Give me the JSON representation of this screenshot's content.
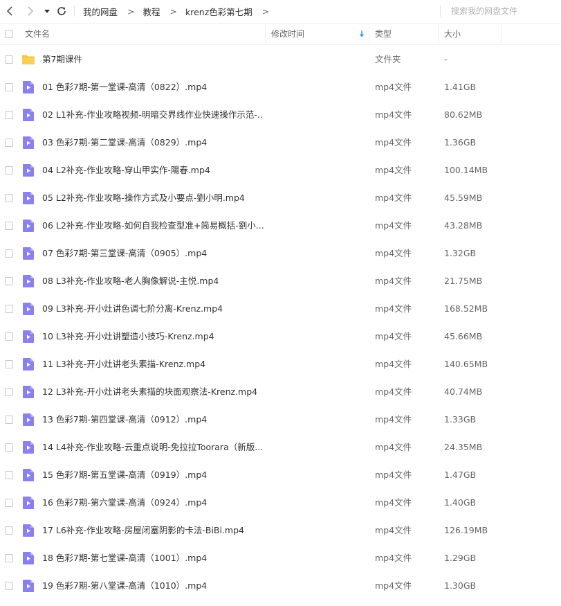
{
  "toolbar": {
    "back_icon": "chevron-left-icon",
    "forward_icon": "chevron-right-icon",
    "dropdown_icon": "caret-down-icon",
    "refresh_icon": "refresh-icon"
  },
  "breadcrumb": {
    "items": [
      "我的网盘",
      "教程",
      "krenz色彩第七期"
    ],
    "separator": ">"
  },
  "search": {
    "placeholder": "搜索我的网盘文件",
    "value": ""
  },
  "columns": {
    "name": "文件名",
    "mtime": "修改时间",
    "type": "类型",
    "size": "大小"
  },
  "colors": {
    "file_icon": "#8b80ef",
    "folder_icon": "#f7c543",
    "sort_arrow": "#2b8cff"
  },
  "files": [
    {
      "name": "第7期课件",
      "type": "文件夹",
      "size": "-",
      "kind": "folder"
    },
    {
      "name": "01  色彩7期-第一堂课-高清（0822）.mp4",
      "type": "mp4文件",
      "size": "1.41GB",
      "kind": "video"
    },
    {
      "name": "02  L1补充-作业攻略视频-明暗交界线作业快速操作示范-...",
      "type": "mp4文件",
      "size": "80.62MB",
      "kind": "video"
    },
    {
      "name": "03  色彩7期-第二堂课-高清（0829）.mp4",
      "type": "mp4文件",
      "size": "1.36GB",
      "kind": "video"
    },
    {
      "name": "04  L2补充-作业攻略-穿山甲实作-陽春.mp4",
      "type": "mp4文件",
      "size": "100.14MB",
      "kind": "video"
    },
    {
      "name": "05  L2补充-作业攻略-操作方式及小要点-劉小明.mp4",
      "type": "mp4文件",
      "size": "45.59MB",
      "kind": "video"
    },
    {
      "name": "06  L2补充-作业攻略-如何自我检查型准+简易概括-劉小...",
      "type": "mp4文件",
      "size": "43.28MB",
      "kind": "video"
    },
    {
      "name": "07  色彩7期-第三堂课-高清（0905）.mp4",
      "type": "mp4文件",
      "size": "1.32GB",
      "kind": "video"
    },
    {
      "name": "08  L3补充-作业攻略-老人胸像解说-主悦.mp4",
      "type": "mp4文件",
      "size": "21.75MB",
      "kind": "video"
    },
    {
      "name": "09  L3补充-开小灶讲色调七阶分离-Krenz.mp4",
      "type": "mp4文件",
      "size": "168.52MB",
      "kind": "video"
    },
    {
      "name": "10  L3补充-开小灶讲塑造小技巧-Krenz.mp4",
      "type": "mp4文件",
      "size": "45.66MB",
      "kind": "video"
    },
    {
      "name": "11  L3补充-开小灶讲老头素描-Krenz.mp4",
      "type": "mp4文件",
      "size": "140.65MB",
      "kind": "video"
    },
    {
      "name": "12  L3补充-开小灶讲老头素描的块面观察法-Krenz.mp4",
      "type": "mp4文件",
      "size": "40.74MB",
      "kind": "video"
    },
    {
      "name": "13  色彩7期-第四堂课-高清（0912）.mp4",
      "type": "mp4文件",
      "size": "1.33GB",
      "kind": "video"
    },
    {
      "name": "14  L4补充-作业攻略-云重点说明-免拉拉Toorara（新版...",
      "type": "mp4文件",
      "size": "24.35MB",
      "kind": "video"
    },
    {
      "name": "15  色彩7期-第五堂课-高清（0919）.mp4",
      "type": "mp4文件",
      "size": "1.47GB",
      "kind": "video"
    },
    {
      "name": "16  色彩7期-第六堂课-高清（0924）.mp4",
      "type": "mp4文件",
      "size": "1.40GB",
      "kind": "video"
    },
    {
      "name": "17  L6补充-作业攻略-房屋闭塞阴影的卡法-BiBi.mp4",
      "type": "mp4文件",
      "size": "126.19MB",
      "kind": "video"
    },
    {
      "name": "18  色彩7期-第七堂课-高清（1001）.mp4",
      "type": "mp4文件",
      "size": "1.29GB",
      "kind": "video"
    },
    {
      "name": "19  色彩7期-第八堂课-高清（1010）.mp4",
      "type": "mp4文件",
      "size": "1.30GB",
      "kind": "video"
    }
  ]
}
